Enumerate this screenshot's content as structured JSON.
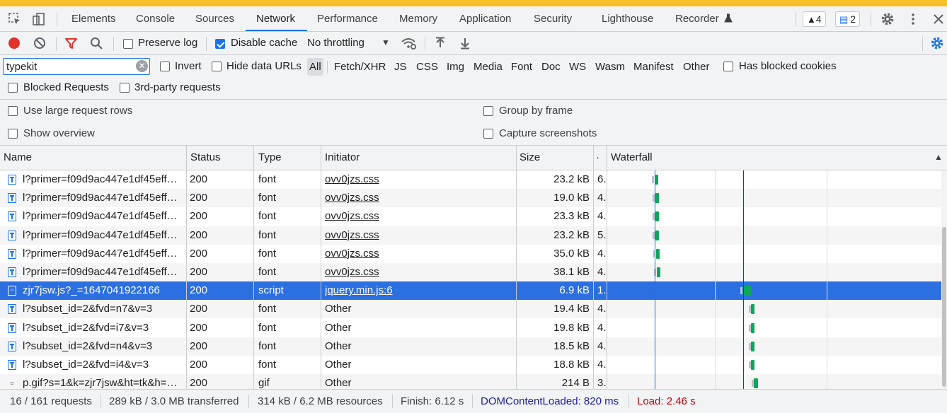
{
  "tabs": [
    "Elements",
    "Console",
    "Sources",
    "Network",
    "Performance",
    "Memory",
    "Application",
    "Security",
    "Lighthouse",
    "Recorder"
  ],
  "active_tab": "Network",
  "badges": {
    "warnings": "4",
    "messages": "2"
  },
  "toolbar": {
    "preserve_log": "Preserve log",
    "disable_cache": "Disable cache",
    "throttling": "No throttling"
  },
  "filter": {
    "value": "typekit",
    "invert": "Invert",
    "hide_data_urls": "Hide data URLs",
    "types": [
      "All",
      "Fetch/XHR",
      "JS",
      "CSS",
      "Img",
      "Media",
      "Font",
      "Doc",
      "WS",
      "Wasm",
      "Manifest",
      "Other"
    ],
    "has_blocked_cookies": "Has blocked cookies",
    "blocked_requests": "Blocked Requests",
    "third_party": "3rd-party requests"
  },
  "settings": {
    "large_rows": "Use large request rows",
    "group_by_frame": "Group by frame",
    "show_overview": "Show overview",
    "capture_screenshots": "Capture screenshots"
  },
  "columns": {
    "name": "Name",
    "status": "Status",
    "type": "Type",
    "initiator": "Initiator",
    "size": "Size",
    "time": "·",
    "waterfall": "Waterfall"
  },
  "rows": [
    {
      "name": "l?primer=f09d9ac447e1df45eff…",
      "status": "200",
      "type": "font",
      "initiator": "ovv0jzs.css",
      "size": "23.2 kB",
      "time": "6."
    },
    {
      "name": "l?primer=f09d9ac447e1df45eff…",
      "status": "200",
      "type": "font",
      "initiator": "ovv0jzs.css",
      "size": "19.0 kB",
      "time": "4."
    },
    {
      "name": "l?primer=f09d9ac447e1df45eff…",
      "status": "200",
      "type": "font",
      "initiator": "ovv0jzs.css",
      "size": "23.3 kB",
      "time": "4."
    },
    {
      "name": "l?primer=f09d9ac447e1df45eff…",
      "status": "200",
      "type": "font",
      "initiator": "ovv0jzs.css",
      "size": "23.2 kB",
      "time": "5."
    },
    {
      "name": "l?primer=f09d9ac447e1df45eff…",
      "status": "200",
      "type": "font",
      "initiator": "ovv0jzs.css",
      "size": "35.0 kB",
      "time": "4."
    },
    {
      "name": "l?primer=f09d9ac447e1df45eff…",
      "status": "200",
      "type": "font",
      "initiator": "ovv0jzs.css",
      "size": "38.1 kB",
      "time": "4."
    },
    {
      "name": "zjr7jsw.js?_=1647041922166",
      "status": "200",
      "type": "script",
      "initiator": "jquery.min.js:6",
      "size": "6.9 kB",
      "time": "1."
    },
    {
      "name": "l?subset_id=2&fvd=n7&v=3",
      "status": "200",
      "type": "font",
      "initiator": "Other",
      "size": "19.4 kB",
      "time": "4."
    },
    {
      "name": "l?subset_id=2&fvd=i7&v=3",
      "status": "200",
      "type": "font",
      "initiator": "Other",
      "size": "19.8 kB",
      "time": "4."
    },
    {
      "name": "l?subset_id=2&fvd=n4&v=3",
      "status": "200",
      "type": "font",
      "initiator": "Other",
      "size": "18.5 kB",
      "time": "4."
    },
    {
      "name": "l?subset_id=2&fvd=i4&v=3",
      "status": "200",
      "type": "font",
      "initiator": "Other",
      "size": "18.8 kB",
      "time": "4."
    },
    {
      "name": "p.gif?s=1&k=zjr7jsw&ht=tk&h=…",
      "status": "200",
      "type": "gif",
      "initiator": "Other",
      "size": "214 B",
      "time": "3."
    }
  ],
  "status_bar": {
    "requests": "16 / 161 requests",
    "transferred": "289 kB / 3.0 MB transferred",
    "resources": "314 kB / 6.2 MB resources",
    "finish": "Finish: 6.12 s",
    "dcl": "DOMContentLoaded: 820 ms",
    "load": "Load: 2.46 s"
  },
  "colors": {
    "accent": "#1a73e8",
    "selected_row": "#2c6fe0",
    "dcl": "#1a1aa6",
    "load": "#c80000",
    "record": "#e0302a"
  }
}
